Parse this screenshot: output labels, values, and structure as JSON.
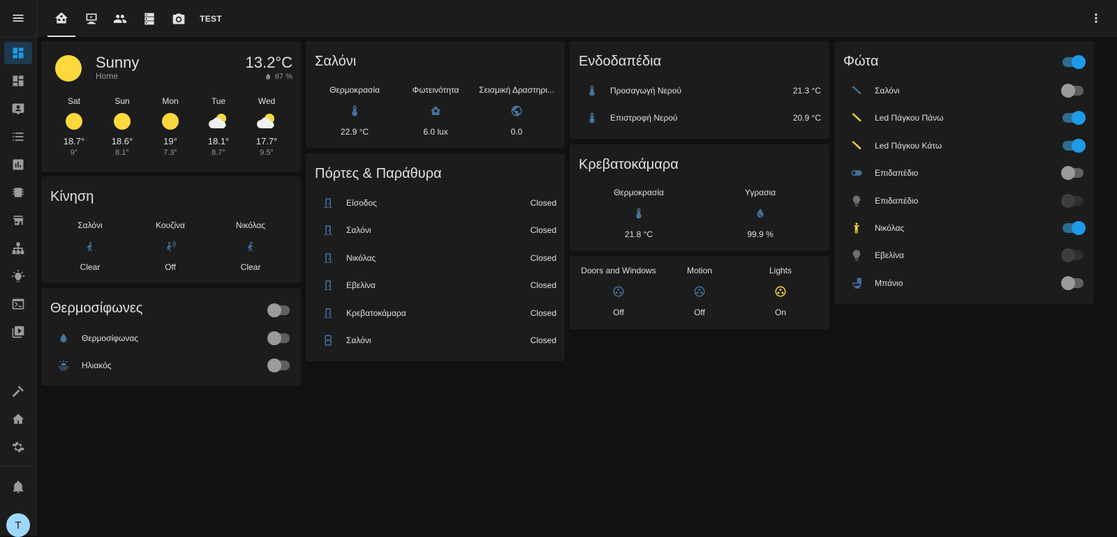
{
  "colors": {
    "accent": "#1e9be9",
    "icon_blue": "#44739e",
    "icon_yellow": "#fdd93d",
    "background": "#111111",
    "card": "#1c1c1c"
  },
  "topbar": {
    "tabs": [
      {
        "icon": "home-assistant-icon"
      },
      {
        "icon": "monitor-icon"
      },
      {
        "icon": "account-group-icon"
      },
      {
        "icon": "server-icon"
      },
      {
        "icon": "camera-icon"
      },
      {
        "label": "TEST"
      }
    ]
  },
  "sidebar": {
    "items": [
      "dashboard-icon",
      "view-dashboard-icon",
      "account-box-icon",
      "format-list-icon",
      "chart-box-icon",
      "chip-icon",
      "store-icon",
      "sitemap-icon",
      "lightbulb-on-icon",
      "console-icon",
      "play-box-icon"
    ],
    "bottom": [
      "hammer-icon",
      "home-cog-icon",
      "cog-icon",
      "bell-icon"
    ],
    "avatar": "T"
  },
  "weather": {
    "condition": "Sunny",
    "location": "Home",
    "temperature": "13.2°C",
    "humidity": "67 %",
    "forecast": [
      {
        "day": "Sat",
        "icon": "sunny",
        "high": "18.7°",
        "low": "9°"
      },
      {
        "day": "Sun",
        "icon": "sunny",
        "high": "18.6°",
        "low": "8.1°"
      },
      {
        "day": "Mon",
        "icon": "sunny",
        "high": "19°",
        "low": "7.3°"
      },
      {
        "day": "Tue",
        "icon": "partly-cloudy",
        "high": "18.1°",
        "low": "8.7°"
      },
      {
        "day": "Wed",
        "icon": "partly-cloudy",
        "high": "17.7°",
        "low": "9.5°"
      }
    ]
  },
  "motion": {
    "title": "Κίνηση",
    "items": [
      {
        "name": "Σαλόνι",
        "state": "Clear"
      },
      {
        "name": "Κουζίνα",
        "state": "Off"
      },
      {
        "name": "Νικόλας",
        "state": "Clear"
      }
    ]
  },
  "boilers": {
    "title": "Θερμοσίφωνες",
    "header_toggle": "off",
    "items": [
      {
        "name": "Θερμοσίφωνας",
        "icon": "water-drop-icon",
        "toggle": "off"
      },
      {
        "name": "Ηλιακός",
        "icon": "sun-wave-icon",
        "toggle": "off"
      }
    ]
  },
  "salon": {
    "title": "Σαλόνι",
    "items": [
      {
        "name": "Θερμοκρασία",
        "icon": "thermometer-icon",
        "value": "22.9 °C"
      },
      {
        "name": "Φωτεινότητα",
        "icon": "home-brightness-icon",
        "value": "6.0 lux"
      },
      {
        "name": "Σεισμική Δραστηρι...",
        "icon": "earth-icon",
        "value": "0.0"
      }
    ]
  },
  "doors": {
    "title": "Πόρτες & Παράθυρα",
    "items": [
      {
        "name": "Είσοδος",
        "icon": "door-closed-icon",
        "state": "Closed"
      },
      {
        "name": "Σαλόνι",
        "icon": "door-closed-icon",
        "state": "Closed"
      },
      {
        "name": "Νικόλας",
        "icon": "door-closed-icon",
        "state": "Closed"
      },
      {
        "name": "Εβελίνα",
        "icon": "door-closed-icon",
        "state": "Closed"
      },
      {
        "name": "Κρεβατοκάμαρα",
        "icon": "door-closed-icon",
        "state": "Closed"
      },
      {
        "name": "Σαλόνι",
        "icon": "window-closed-icon",
        "state": "Closed"
      }
    ]
  },
  "floor": {
    "title": "Ενδοδαπέδια",
    "items": [
      {
        "name": "Προσαγωγή Νερού",
        "icon": "thermometer-icon",
        "value": "21.3 °C"
      },
      {
        "name": "Επιστροφή Νερού",
        "icon": "thermometer-icon",
        "value": "20.9 °C"
      }
    ]
  },
  "bedroom": {
    "title": "Κρεβατοκάμαρα",
    "items": [
      {
        "name": "Θερμοκρασία",
        "icon": "thermometer-icon",
        "value": "21.8 °C"
      },
      {
        "name": "Υγρασια",
        "icon": "water-percent-icon",
        "value": "99.9 %"
      }
    ]
  },
  "groups": {
    "items": [
      {
        "name": "Doors and Windows",
        "icon": "google-circles-icon",
        "value": "Off"
      },
      {
        "name": "Motion",
        "icon": "google-circles-icon",
        "value": "Off"
      },
      {
        "name": "Lights",
        "icon": "google-circles-icon",
        "value": "On"
      }
    ]
  },
  "lights": {
    "title": "Φώτα",
    "header_toggle": "on",
    "items": [
      {
        "name": "Σαλόνι",
        "icon": "led-strip-icon",
        "toggle": "off"
      },
      {
        "name": "Led Πάγκου Πάνω",
        "icon": "led-strip-icon",
        "toggle": "on"
      },
      {
        "name": "Led Πάγκου Κάτω",
        "icon": "led-strip-icon",
        "toggle": "on"
      },
      {
        "name": "Επιδαπέδιο",
        "icon": "toggle-switch-icon",
        "toggle": "off"
      },
      {
        "name": "Επιδαπέδιο",
        "icon": "lightbulb-icon",
        "toggle": "unavailable"
      },
      {
        "name": "Νικόλας",
        "icon": "human-icon",
        "toggle": "on"
      },
      {
        "name": "Εβελίνα",
        "icon": "lightbulb-icon",
        "toggle": "unavailable"
      },
      {
        "name": "Μπάνιο",
        "icon": "toilet-icon",
        "toggle": "off"
      }
    ]
  }
}
